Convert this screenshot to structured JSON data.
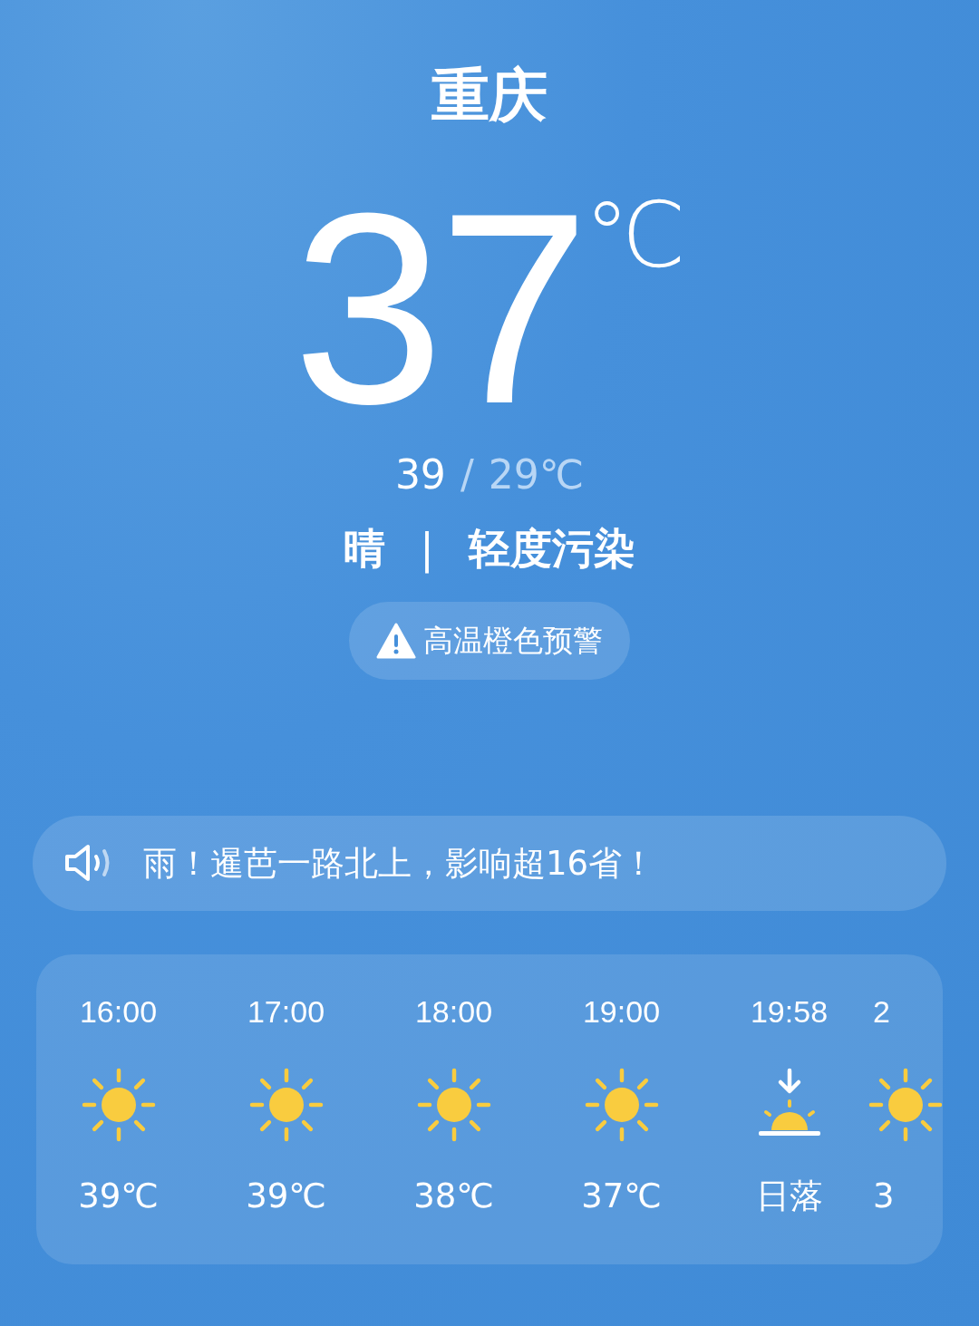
{
  "city": "重庆",
  "temperature": {
    "value": "37",
    "unit": "℃"
  },
  "range": {
    "high": "39",
    "separator": "/",
    "low": "29℃"
  },
  "condition": "晴",
  "divider": "|",
  "air_quality": "轻度污染",
  "alert": {
    "label": "高温橙色预警"
  },
  "news_ticker": {
    "text": "雨！暹芭一路北上，影响超16省！"
  },
  "hourly": [
    {
      "time": "16:00",
      "kind": "sun",
      "label": "39℃"
    },
    {
      "time": "17:00",
      "kind": "sun",
      "label": "39℃"
    },
    {
      "time": "18:00",
      "kind": "sun",
      "label": "38℃"
    },
    {
      "time": "19:00",
      "kind": "sun",
      "label": "37℃"
    },
    {
      "time": "19:58",
      "kind": "sunset",
      "label": "日落"
    },
    {
      "time": "2",
      "kind": "sun",
      "label": "3"
    }
  ]
}
